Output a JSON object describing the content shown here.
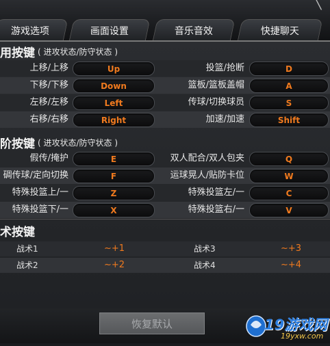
{
  "tabs": [
    "游戏选项",
    "画面设置",
    "音乐音效",
    "快捷聊天"
  ],
  "close_glyph": "╲",
  "sections": {
    "common": {
      "title": "用按键",
      "subtitle": "( 进攻状态/防守状态 )"
    },
    "advanced": {
      "title": "阶按键",
      "subtitle": "( 进攻状态/防守状态 )"
    },
    "tactics": {
      "title": "术按键"
    }
  },
  "common_rows": [
    {
      "left_label": "上移/上移",
      "left_key": "Up",
      "right_label": "投篮/抢断",
      "right_key": "D"
    },
    {
      "left_label": "下移/下移",
      "left_key": "Down",
      "right_label": "篮板/篮板盖帽",
      "right_key": "A"
    },
    {
      "left_label": "左移/左移",
      "left_key": "Left",
      "right_label": "传球/切换球员",
      "right_key": "S"
    },
    {
      "left_label": "右移/右移",
      "left_key": "Right",
      "right_label": "加速/加速",
      "right_key": "Shift"
    }
  ],
  "advanced_rows": [
    {
      "left_label": "假传/掩护",
      "left_key": "E",
      "right_label": "双人配合/双人包夹",
      "right_key": "Q"
    },
    {
      "left_label": "碉传球/定向切换",
      "left_key": "F",
      "right_label": "运球晃人/贴防卡位",
      "right_key": "W"
    },
    {
      "left_label": "特殊投篮上/一",
      "left_key": "Z",
      "right_label": "特殊投篮左/一",
      "right_key": "C"
    },
    {
      "left_label": "特殊投篮下/一",
      "left_key": "X",
      "right_label": "特殊投篮右/一",
      "right_key": "V"
    }
  ],
  "tactic_rows": [
    {
      "left_label": "战术1",
      "left_key": "~+1",
      "right_label": "战术3",
      "right_key": "~+3"
    },
    {
      "left_label": "战术2",
      "left_key": "~+2",
      "right_label": "战术4",
      "right_key": "~+4"
    }
  ],
  "footer": {
    "restore_label": "恢复默认"
  },
  "watermark": {
    "brand": "19游戏网",
    "domain": "19yxw.com"
  },
  "colors": {
    "key_text": "#f07a1e",
    "background": "#1a1c1f"
  }
}
